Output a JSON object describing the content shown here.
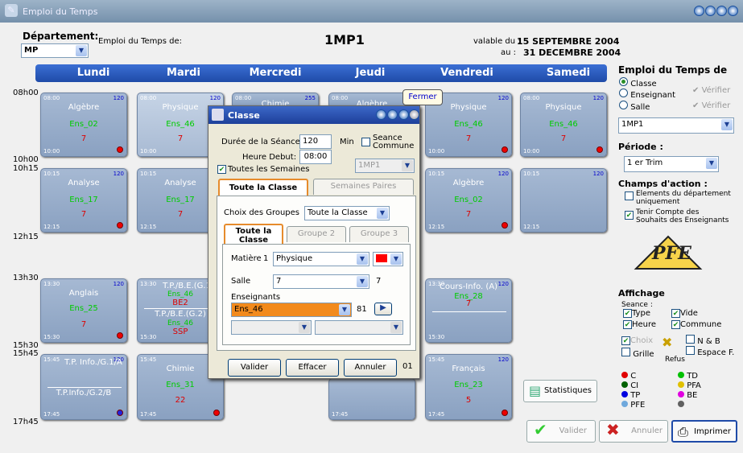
{
  "app": {
    "title": "Emploi du Temps"
  },
  "header": {
    "departement_label": "Département:",
    "departement_value": "MP",
    "edt_de_label": "Emploi du Temps de:",
    "class_code": "1MP1",
    "valable_label": "valable du :",
    "valable_from": "15 SEPTEMBRE 2004",
    "au_label": "au :",
    "valable_to": "31 DECEMBRE 2004"
  },
  "days": [
    "Lundi",
    "Mardi",
    "Mercredi",
    "Jeudi",
    "Vendredi",
    "Samedi"
  ],
  "times": {
    "t1": "08h00",
    "t2": "10h00",
    "t3": "10h15",
    "t4": "12h15",
    "t5": "13h30",
    "t6": "15h30",
    "t7": "15h45",
    "t8": "17h45"
  },
  "cards": {
    "lundi1": {
      "start": "08:00",
      "dur": "120",
      "end": "10:00",
      "subject": "Algèbre",
      "ens": "Ens_02",
      "room": "7"
    },
    "mardi1": {
      "start": "08:00",
      "dur": "120",
      "end": "10:00",
      "subject": "Physique",
      "ens": "Ens_46",
      "room": "7"
    },
    "merc1": {
      "start": "08:00",
      "dur": "255",
      "subject": "Chimie"
    },
    "jeudi1": {
      "start": "08:00",
      "subject": "Algèbre"
    },
    "vend1": {
      "dur": "120",
      "end": "10:00",
      "subject": "Physique",
      "ens": "Ens_46",
      "room": "7"
    },
    "sam1": {
      "start": "08:00",
      "dur": "120",
      "end": "10:00",
      "subject": "Physique",
      "ens": "Ens_46",
      "room": "7"
    },
    "lundi2": {
      "start": "10:15",
      "dur": "120",
      "end": "12:15",
      "subject": "Analyse",
      "ens": "Ens_17",
      "room": "7"
    },
    "mardi2": {
      "start": "10:15",
      "end": "12:15",
      "subject": "Analyse",
      "ens": "Ens_17",
      "room": "7"
    },
    "vend2": {
      "start": "10:15",
      "dur": "120",
      "end": "12:15",
      "subject": "Algèbre",
      "ens": "Ens_02",
      "room": "7"
    },
    "sam2": {
      "start": "10:15",
      "dur": "120",
      "end": "12:15"
    },
    "lundi3": {
      "start": "13:30",
      "dur": "120",
      "end": "15:30",
      "subject": "Anglais",
      "ens": "Ens_25",
      "room": "7"
    },
    "mardi3": {
      "start": "13:30",
      "dur": "120",
      "end": "15:30",
      "l1": "T.P./B.E.(G.1)",
      "l1ens": "Ens_46",
      "l1room": "BE2",
      "l2": "T.P./B.E.(G.2)",
      "l2ens": "Ens_46",
      "l2room": "SSP"
    },
    "vend3": {
      "start": "13:30",
      "dur": "120",
      "end": "15:30",
      "subject": "Cours-Info. (A)",
      "ens": "Ens_28",
      "room": "7"
    },
    "lundi4": {
      "start": "15:45",
      "dur": "120",
      "end": "17:45",
      "l1": "T.P. Info./G.1/A",
      "l2": "T.P.Info./G.2/B"
    },
    "mardi4": {
      "start": "15:45",
      "end": "17:45",
      "subject": "Chimie",
      "ens": "Ens_31",
      "room": "22"
    },
    "jeudi4": {
      "end": "17:45"
    },
    "vend4": {
      "start": "15:45",
      "dur": "120",
      "end": "17:45",
      "subject": "Français",
      "ens": "Ens_23",
      "room": "5"
    }
  },
  "tooltip": "Fermer",
  "dialog": {
    "title": "Classe",
    "duree_label": "Durée de la Séance:",
    "duree_value": "120",
    "min_label": "Min",
    "seance_commune": "Seance Commune",
    "heure_debut_label": "Heure Debut:",
    "heure_debut_value": "08:00",
    "toutes_semaines": "Toutes les Semaines",
    "class_sel": "1MP1",
    "tab_toute": "Toute la Classe",
    "tab_paires": "Semaines Paires",
    "choix_groupes_label": "Choix des Groupes",
    "choix_groupes_value": "Toute la Classe",
    "subtab1": "Toute la Classe",
    "subtab2": "Groupe 2",
    "subtab3": "Groupe 3",
    "matiere_label": "Matière",
    "matiere_num": "1",
    "matiere_value": "Physique",
    "salle_label": "Salle",
    "salle_value": "7",
    "salle_num": "7",
    "enseignants_label": "Enseignants",
    "ens_value": "Ens_46",
    "ens_num": "81",
    "valider": "Valider",
    "effacer": "Effacer",
    "annuler": "Annuler",
    "code": "01"
  },
  "right": {
    "edt_de": "Emploi du Temps de",
    "opt_classe": "Classe",
    "opt_ens": "Enseignant",
    "opt_salle": "Salle",
    "verifier": "Vérifier",
    "select": "1MP1",
    "periode_label": "Période :",
    "periode_value": "1 er Trim",
    "champs": "Champs d'action :",
    "chk1": "Elements du département uniquement",
    "chk2": "Tenir Compte des Souhaits des Enseignants",
    "logo": "PFE MANAR",
    "affichage": "Affichage",
    "seance": "Seance :",
    "type": "Type",
    "vide": "Vide",
    "heure": "Heure",
    "commune": "Commune",
    "choix": "Choix",
    "nb": "N & B",
    "grille": "Grille",
    "espace": "Espace F.",
    "refus": "Refus",
    "legend": [
      {
        "k": "C",
        "c": "#e00000"
      },
      {
        "k": "TD",
        "c": "#00c000"
      },
      {
        "k": "CI",
        "c": "#006000"
      },
      {
        "k": "PFA",
        "c": "#e0c000"
      },
      {
        "k": "TP",
        "c": "#0000e0"
      },
      {
        "k": "BE",
        "c": "#e000e0"
      },
      {
        "k": "PFE",
        "c": "#6fa8dc"
      },
      {
        "k": "",
        "c": "#606060"
      }
    ],
    "stat": "Statistiques",
    "valider": "Valider",
    "annuler": "Annuler",
    "imprimer": "Imprimer"
  }
}
